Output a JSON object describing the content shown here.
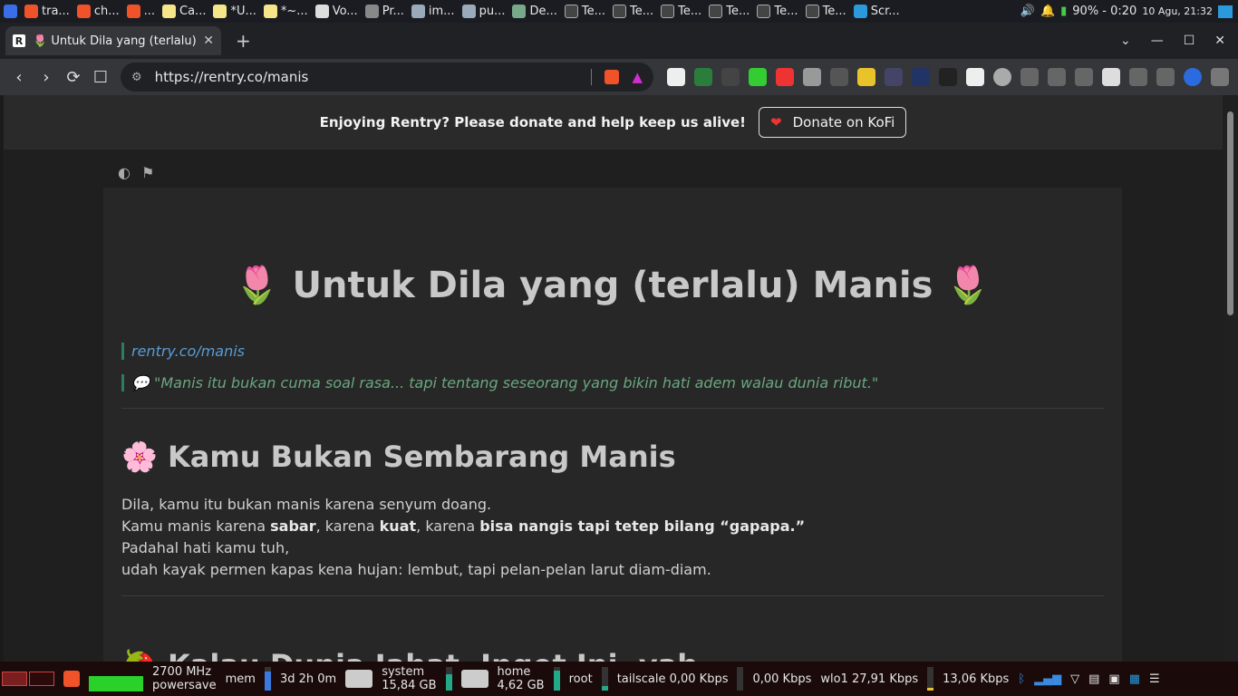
{
  "topbar": {
    "tasks": [
      "tra...",
      "ch...",
      "...",
      "Ca...",
      "*U...",
      "*~...",
      "Vo...",
      "Pr...",
      "im...",
      "pu...",
      "De...",
      "Te...",
      "Te...",
      "Te...",
      "Te...",
      "Te...",
      "Te...",
      "Scr..."
    ],
    "battery": "90% - 0:20",
    "clock": "10 Agu, 21:32"
  },
  "tab": {
    "title": "🌷 Untuk Dila yang (terlalu) M",
    "close": "✕",
    "new": "+"
  },
  "window": {
    "min": "—",
    "max": "☐",
    "close": "✕",
    "menu": "⌄"
  },
  "nav": {
    "url": "https://rentry.co/manis",
    "back": "‹",
    "forward": "›",
    "reload": "⟳",
    "bookmark": "☐"
  },
  "banner": {
    "text": "Enjoying Rentry? Please donate and help keep us alive!",
    "button": "Donate on KoFi",
    "heart": "❤"
  },
  "page": {
    "title": "🌷 Untuk Dila yang (terlalu) Manis 🌷",
    "link": "rentry.co/manis",
    "quote": "💬 \"Manis itu bukan cuma soal rasa... tapi tentang seseorang yang bikin hati adem walau dunia ribut.\"",
    "h2": "🌸 Kamu Bukan Sembarang Manis",
    "p1": "Dila, kamu itu bukan manis karena senyum doang.",
    "p2a": "Kamu manis karena ",
    "p2b": "sabar",
    "p2c": ", karena ",
    "p2d": "kuat",
    "p2e": ", karena ",
    "p2f": "bisa nangis tapi tetep bilang “gapapa.”",
    "p3": "Padahal hati kamu tuh,",
    "p4": "udah kayak permen kapas kena hujan: lembut, tapi pelan-pelan larut diam-diam.",
    "h2b": "🍓 Kalau Dunia Jahat, Inget Ini, yah..."
  },
  "taskbar": {
    "cpu": "2700 MHz",
    "gov": "powersave",
    "mem": "mem",
    "uptime": "3d 2h 0m",
    "sys_label": "system",
    "sys_size": "15,84 GB",
    "home_label": "home",
    "home_size": "4,62 GB",
    "root": "root",
    "tailscale": "tailscale 0,00 Kbps",
    "ts_up": "0,00 Kbps",
    "wlo": "wlo1 27,91 Kbps",
    "wlo_up": "13,06 Kbps"
  }
}
